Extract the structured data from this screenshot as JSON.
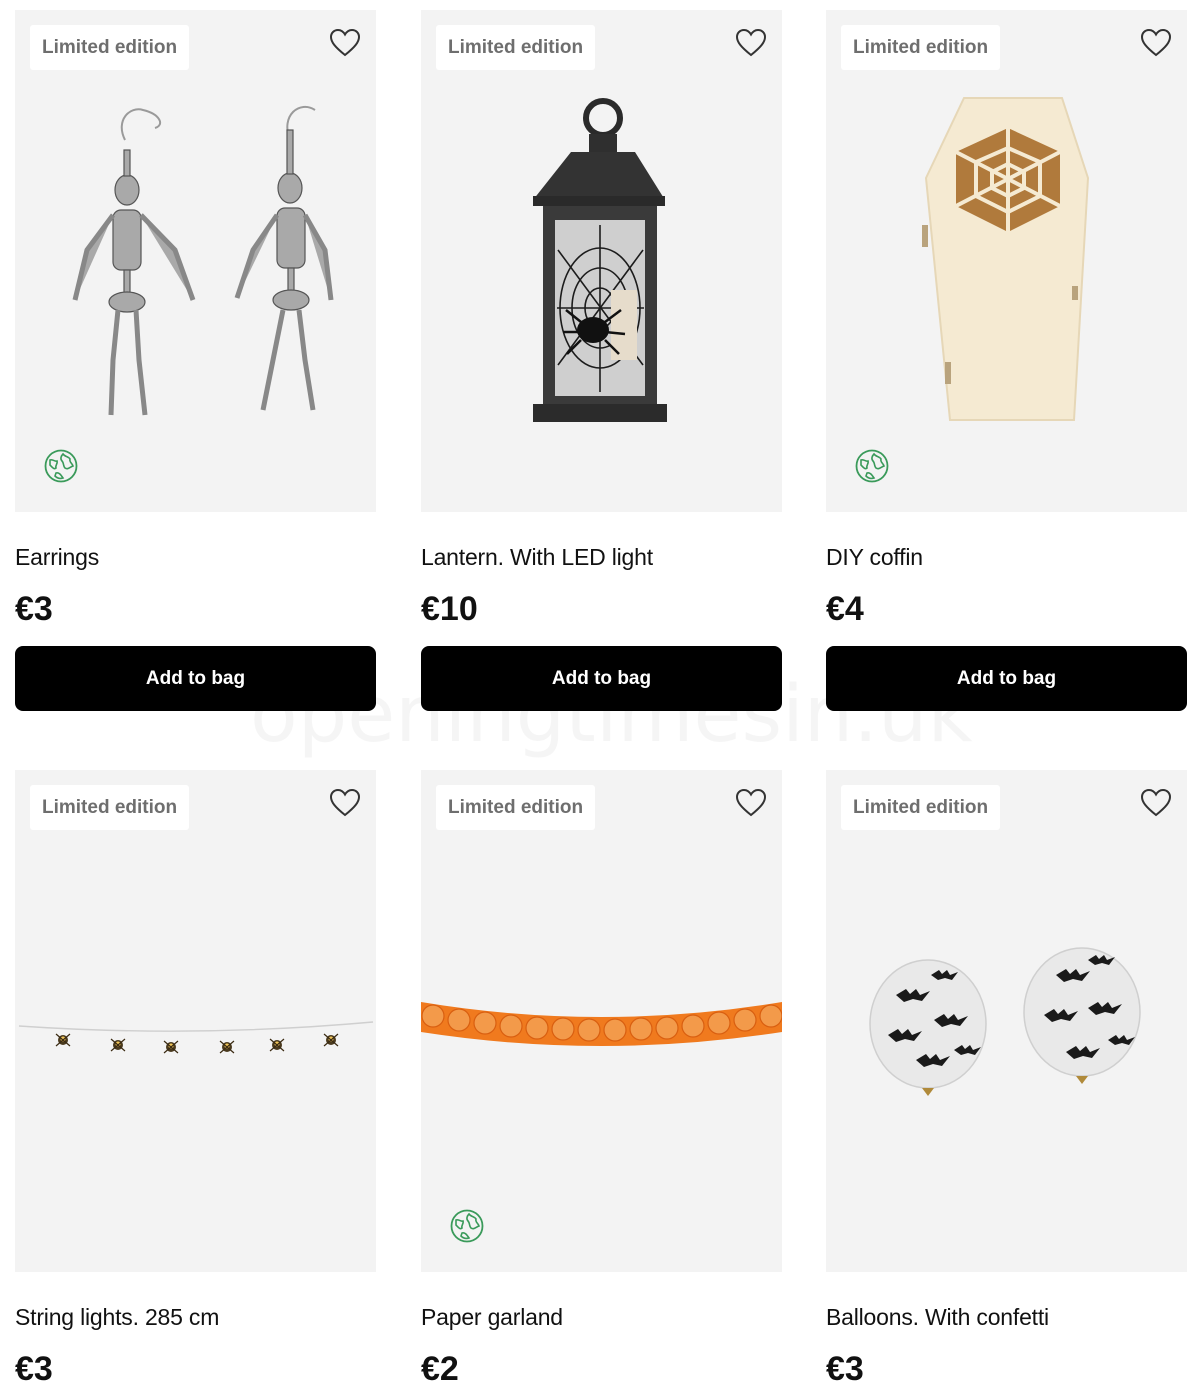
{
  "colors": {
    "card_bg": "#f3f3f3",
    "button_bg": "#000000",
    "badge_text": "#6e6e6e",
    "eco_green": "#3a9a5a",
    "garland_orange": "#f07a1e"
  },
  "products": [
    {
      "badge": "Limited edition",
      "name": "Earrings",
      "price": "€3",
      "button": "Add to bag",
      "eco_icon": "globe-leaf-icon",
      "image": "skeleton-earrings"
    },
    {
      "badge": "Limited edition",
      "name": "Lantern. With LED light",
      "price": "€10",
      "button": "Add to bag",
      "image": "spiderweb-lantern"
    },
    {
      "badge": "Limited edition",
      "name": "DIY coffin",
      "price": "€4",
      "button": "Add to bag",
      "eco_icon": "globe-leaf-icon",
      "image": "wooden-coffin"
    },
    {
      "badge": "Limited edition",
      "name": "String lights. 285 cm",
      "price": "€3",
      "image": "spider-string-lights"
    },
    {
      "badge": "Limited edition",
      "name": "Paper garland",
      "price": "€2",
      "eco_icon": "globe-leaf-icon",
      "image": "pumpkin-garland"
    },
    {
      "badge": "Limited edition",
      "name": "Balloons. With confetti",
      "price": "€3",
      "image": "bat-confetti-balloons"
    }
  ],
  "watermark": "openingtimesin.uk"
}
